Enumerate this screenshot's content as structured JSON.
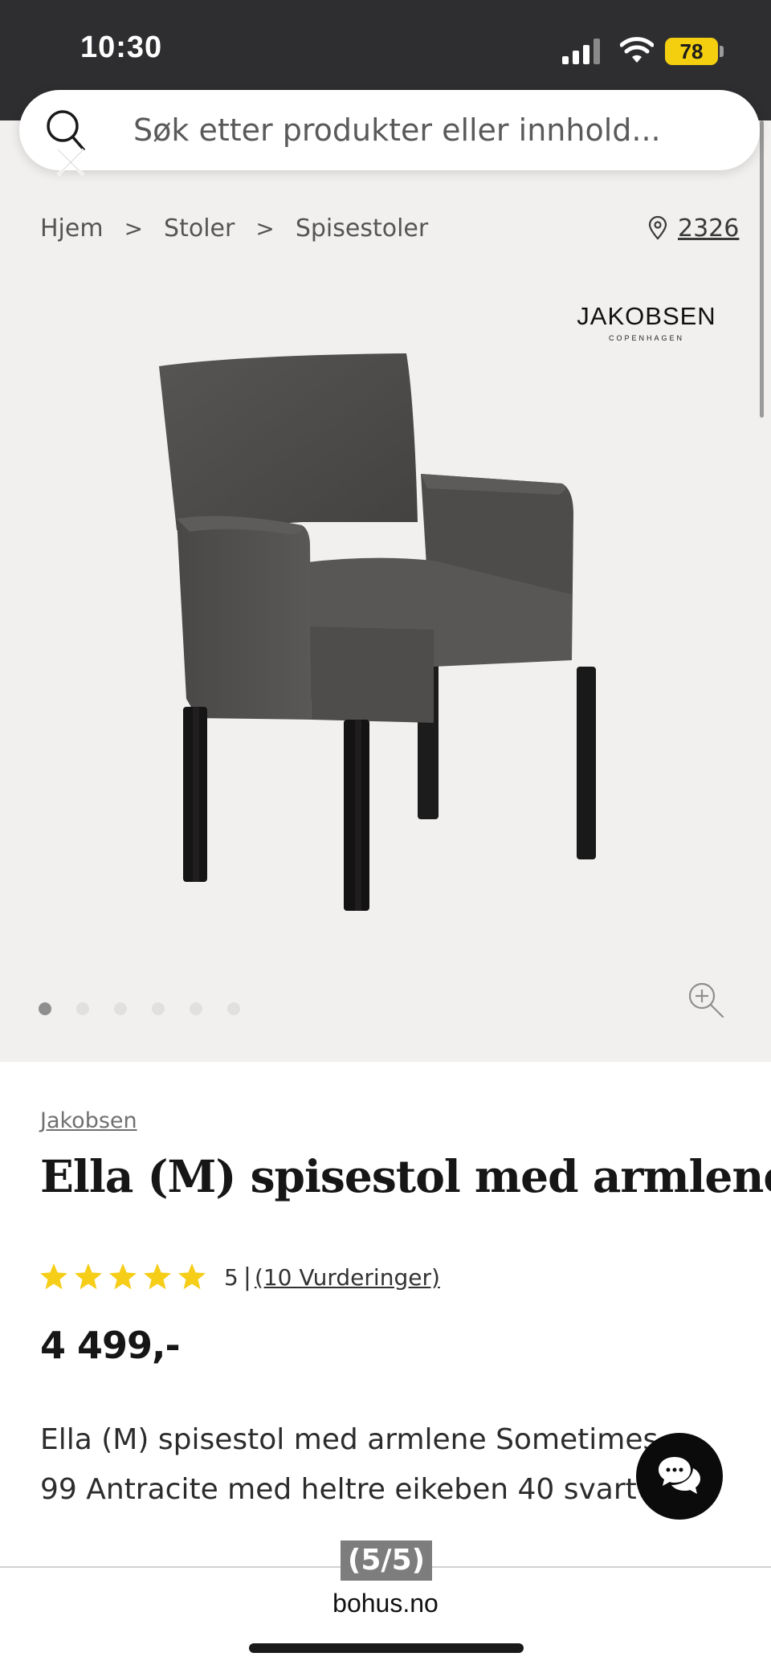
{
  "status_bar": {
    "time": "10:30",
    "battery": "78"
  },
  "search": {
    "placeholder": "Søk etter produkter eller innhold..."
  },
  "breadcrumb": {
    "items": [
      "Hjem",
      "Stoler",
      "Spisestoler"
    ],
    "separator": ">"
  },
  "store": {
    "code": "2326"
  },
  "brand_logo": {
    "name": "JAKOBSEN",
    "subtitle": "COPENHAGEN"
  },
  "carousel": {
    "total_images": 6,
    "active_index": 0
  },
  "product": {
    "brand": "Jakobsen",
    "title": "Ella (M) spisestol med armlene",
    "rating_stars": 5,
    "rating_value": "5",
    "rating_separator": "|",
    "reviews_label": "(10 Vurderinger)",
    "price": "4 499,-",
    "description": "Ella (M) spisestol med armlene Sometimes 99 Antracite med heltre eikeben 40 svart"
  },
  "browser": {
    "page_counter": "(5/5)",
    "domain": "bohus.no"
  },
  "colors": {
    "status_bar": "#2e2e30",
    "battery": "#f4cf10",
    "page_background": "#f2f0ee",
    "star": "#f6cd17",
    "chat_button": "#0b0b0b",
    "chair": "#504e4c"
  }
}
